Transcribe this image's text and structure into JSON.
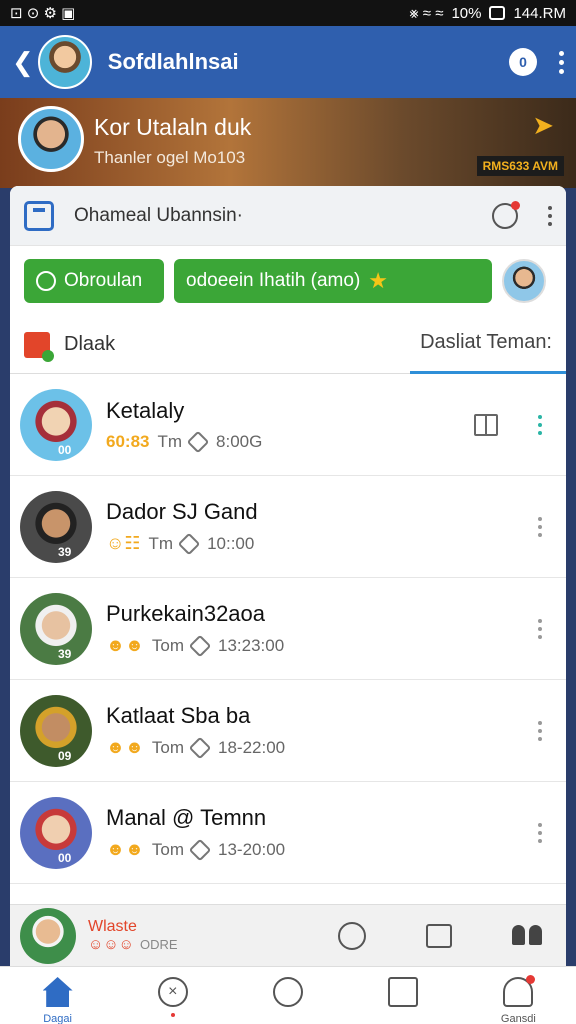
{
  "status_bar": {
    "icons_left": "⊡ ⊙ ⚙ ▣",
    "icons_right": "⨳ ≈ ≈",
    "battery": "10%",
    "time": "144.RM"
  },
  "app_bar": {
    "title": "Sofdlahlnsai",
    "badge": "0"
  },
  "banner": {
    "name": "Kor Utalaln duk",
    "subtitle": "Thanler ogel Mo103",
    "tag": "RMS633 AVM"
  },
  "card_header": {
    "title": "Ohameal Ubannsin·"
  },
  "chips": {
    "chip1": "Obroulan",
    "chip2": "odoeein Ihatih (amo)"
  },
  "tabs": {
    "left": "Dlaak",
    "right": "Dasliat Teman:"
  },
  "contacts": [
    {
      "name": "Ketalaly",
      "emoji": "",
      "code": "60:83",
      "label": "Tm",
      "time": "8:00G",
      "level": "00",
      "avatar_colors": [
        "#f1d3b3",
        "#a52f3a",
        "#6cc1e8"
      ]
    },
    {
      "name": "Dador SJ Gand",
      "emoji": "☺☷",
      "code": "",
      "label": "Tm",
      "time": "10::00",
      "level": "39",
      "avatar_colors": [
        "#c8946a",
        "#222222",
        "#4a4a4a"
      ]
    },
    {
      "name": "Purkekain32aoa",
      "emoji": "☻☻",
      "code": "",
      "label": "Tom",
      "time": "13:23:00",
      "level": "39",
      "avatar_colors": [
        "#e7c2a1",
        "#f0f0f0",
        "#4b7b44"
      ]
    },
    {
      "name": "Katlaat Sba ba",
      "emoji": "☻☻",
      "code": "",
      "label": "Tom",
      "time": "18-22:00",
      "level": "09",
      "avatar_colors": [
        "#c28d63",
        "#d4a12a",
        "#3e5a2c"
      ]
    },
    {
      "name": "Manal @ Temnn",
      "emoji": "☻☻",
      "code": "",
      "label": "Tom",
      "time": "13-20:00",
      "level": "00",
      "avatar_colors": [
        "#f0cfb0",
        "#c73a3a",
        "#5a6fc0"
      ]
    }
  ],
  "mini_player": {
    "name": "Wlaste",
    "emoji": "☺☺☺",
    "meta": "ODRE"
  },
  "bottom_nav": {
    "home": "Dagai",
    "profile": "Gansdi"
  }
}
